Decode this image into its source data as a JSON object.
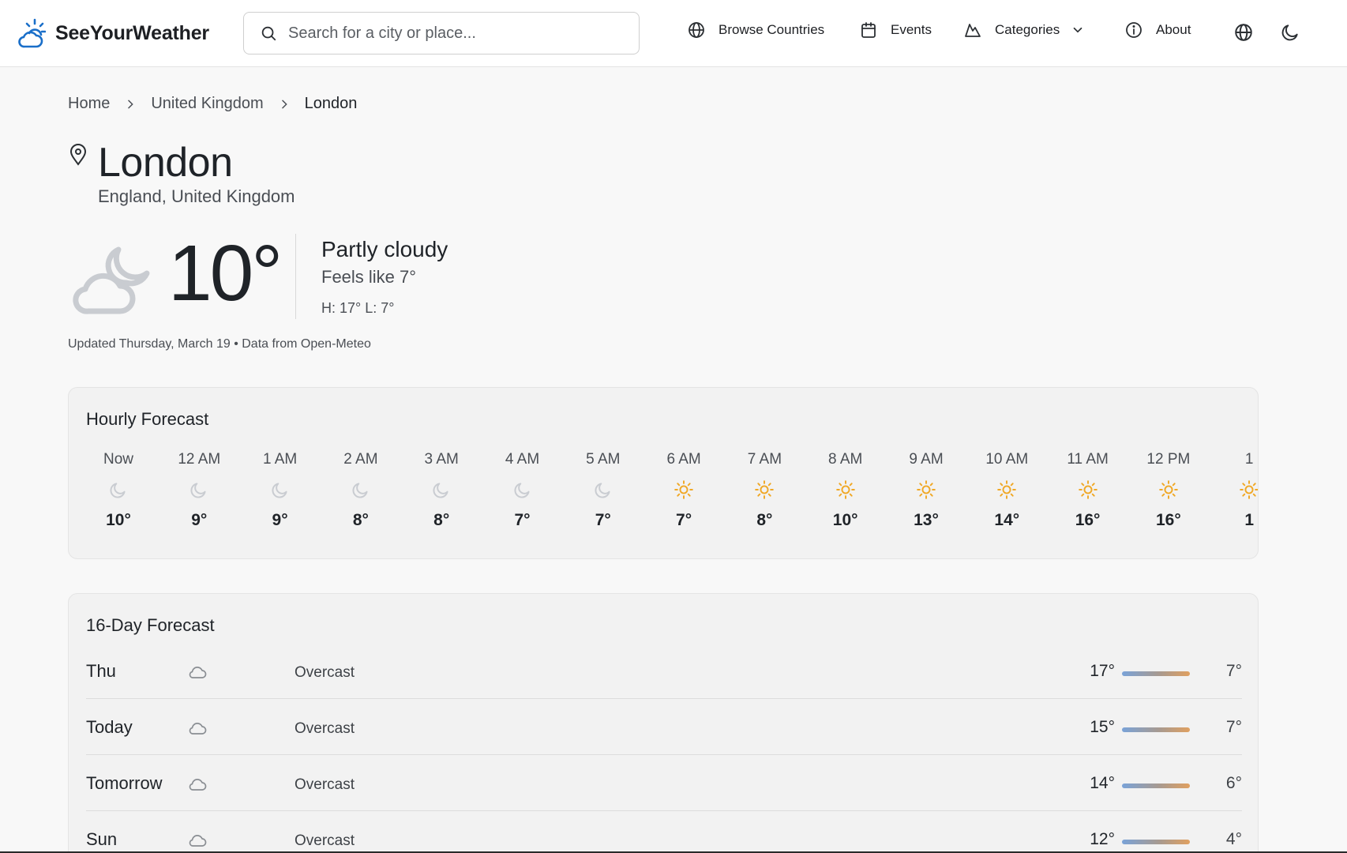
{
  "brand": {
    "name": "SeeYourWeather",
    "accent": "#1a6fc9"
  },
  "search": {
    "placeholder": "Search for a city or place..."
  },
  "nav": {
    "browse_countries": "Browse Countries",
    "events": "Events",
    "categories": "Categories",
    "about": "About"
  },
  "breadcrumb": {
    "home": "Home",
    "country": "United Kingdom",
    "city": "London"
  },
  "location": {
    "city": "London",
    "region": "England, United Kingdom"
  },
  "current": {
    "temp": "10°",
    "condition": "Partly cloudy",
    "feels_like": "Feels like 7°",
    "hi_lo": "H: 17° L: 7°",
    "updated": "Updated Thursday, March 19 • Data from Open-Meteo",
    "icon": "partly-cloudy-night-icon"
  },
  "hourly": {
    "title": "Hourly Forecast",
    "items": [
      {
        "label": "Now",
        "icon": "moon",
        "temp": "10°"
      },
      {
        "label": "12 AM",
        "icon": "moon",
        "temp": "9°"
      },
      {
        "label": "1 AM",
        "icon": "moon",
        "temp": "9°"
      },
      {
        "label": "2 AM",
        "icon": "moon",
        "temp": "8°"
      },
      {
        "label": "3 AM",
        "icon": "moon",
        "temp": "8°"
      },
      {
        "label": "4 AM",
        "icon": "moon",
        "temp": "7°"
      },
      {
        "label": "5 AM",
        "icon": "moon",
        "temp": "7°"
      },
      {
        "label": "6 AM",
        "icon": "sun",
        "temp": "7°"
      },
      {
        "label": "7 AM",
        "icon": "sun",
        "temp": "8°"
      },
      {
        "label": "8 AM",
        "icon": "sun",
        "temp": "10°"
      },
      {
        "label": "9 AM",
        "icon": "sun",
        "temp": "13°"
      },
      {
        "label": "10 AM",
        "icon": "sun",
        "temp": "14°"
      },
      {
        "label": "11 AM",
        "icon": "sun",
        "temp": "16°"
      },
      {
        "label": "12 PM",
        "icon": "sun",
        "temp": "16°"
      },
      {
        "label": "1",
        "icon": "sun",
        "temp": "1"
      }
    ]
  },
  "daily": {
    "title": "16-Day Forecast",
    "items": [
      {
        "day": "Thu",
        "icon": "cloud",
        "condition": "Overcast",
        "high": "17°",
        "low": "7°"
      },
      {
        "day": "Today",
        "icon": "cloud",
        "condition": "Overcast",
        "high": "15°",
        "low": "7°"
      },
      {
        "day": "Tomorrow",
        "icon": "cloud",
        "condition": "Overcast",
        "high": "14°",
        "low": "6°"
      },
      {
        "day": "Sun",
        "icon": "cloud",
        "condition": "Overcast",
        "high": "12°",
        "low": "4°"
      }
    ]
  },
  "colors": {
    "sun": "#f0a826",
    "moon": "#c9ccd1",
    "cloud": "#8a8e93"
  }
}
